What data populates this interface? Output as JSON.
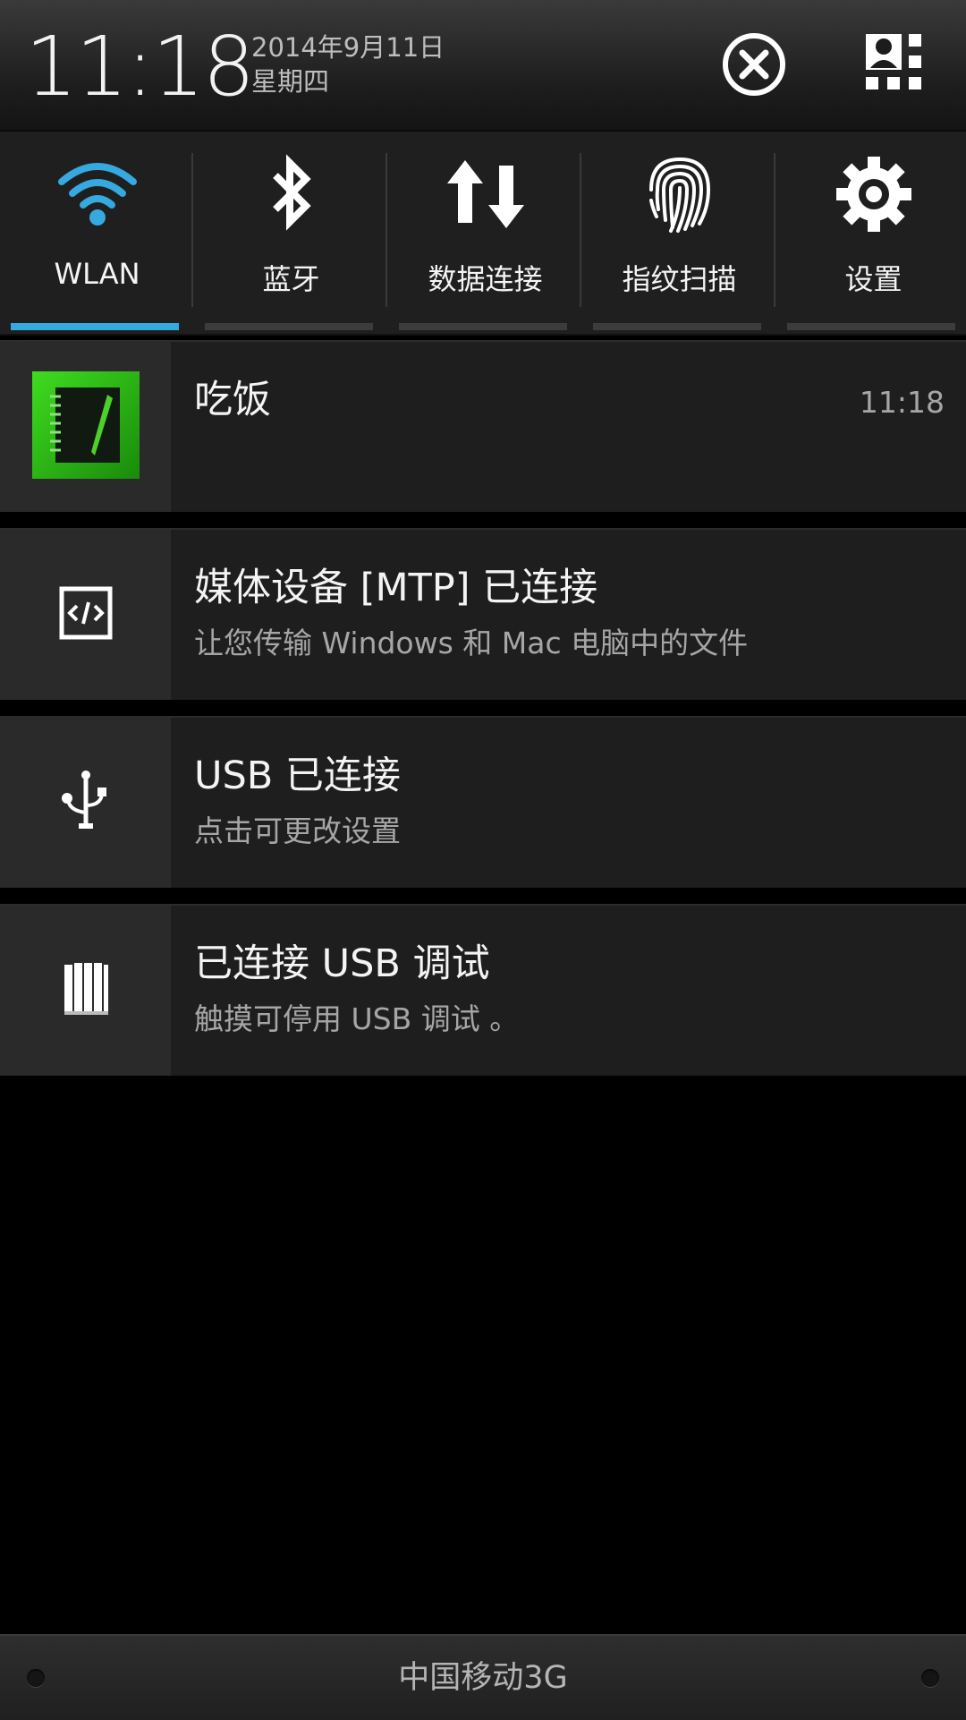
{
  "status_header": {
    "time": "11:18",
    "date": "2014年9月11日",
    "weekday": "星期四",
    "close_icon": "close-circle-icon",
    "profile_icon": "profile-grid-icon"
  },
  "quick_settings": {
    "accent_color": "#35a9e0",
    "tiles": [
      {
        "label": "WLAN",
        "icon": "wifi-icon",
        "active": true
      },
      {
        "label": "蓝牙",
        "icon": "bluetooth-icon",
        "active": false
      },
      {
        "label": "数据连接",
        "icon": "data-transfer-icon",
        "active": false
      },
      {
        "label": "指纹扫描",
        "icon": "fingerprint-icon",
        "active": false
      },
      {
        "label": "设置",
        "icon": "gear-icon",
        "active": false
      }
    ]
  },
  "notifications": [
    {
      "title": "吃饭",
      "time": "11:18",
      "subtitle": "",
      "icon": "notebook-app-icon"
    },
    {
      "title": "媒体设备 [MTP] 已连接",
      "subtitle": "让您传输 Windows 和 Mac 电脑中的文件",
      "icon": "code-icon"
    },
    {
      "title": "USB 已连接",
      "subtitle": "点击可更改设置",
      "icon": "usb-icon"
    },
    {
      "title": "已连接 USB 调试",
      "subtitle": "触摸可停用 USB 调试 。",
      "icon": "usb-debug-icon"
    }
  ],
  "carrier_bar": {
    "label": "中国移动3G"
  }
}
